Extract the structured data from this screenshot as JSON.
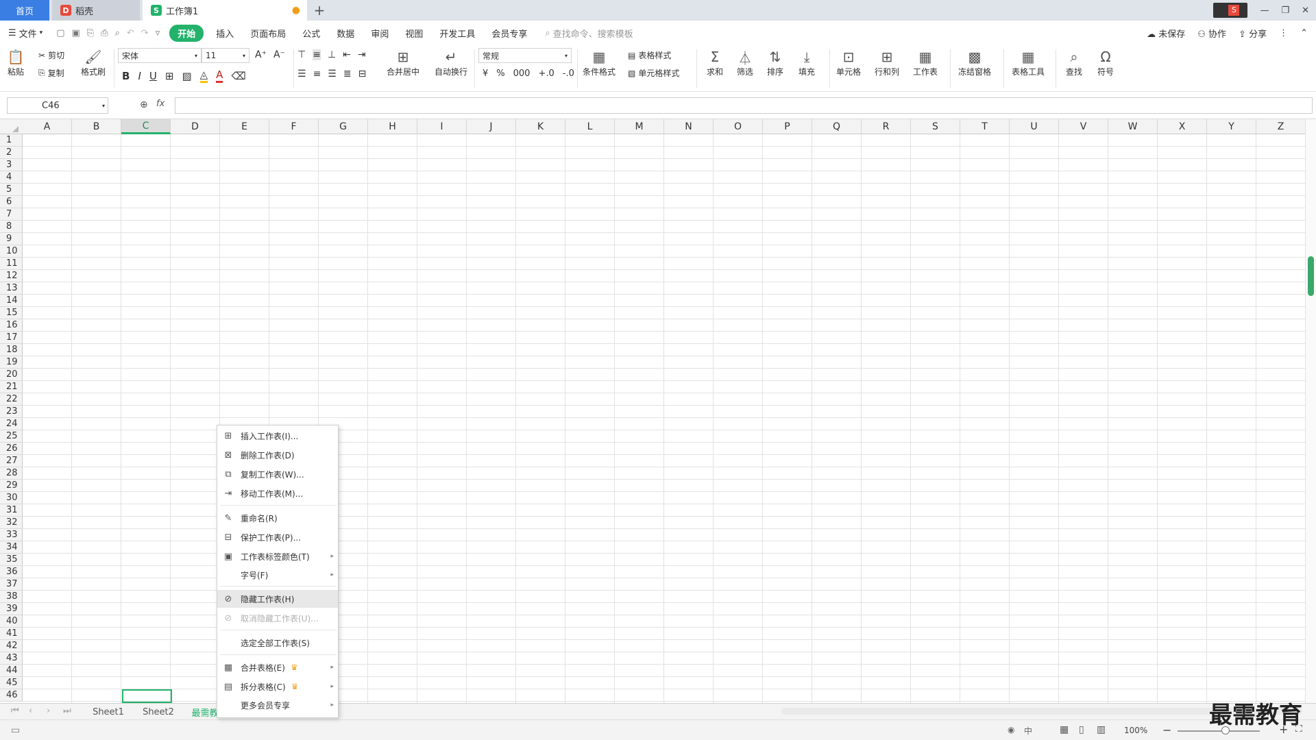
{
  "titlebar": {
    "home_tab": "首页",
    "draft_tab": "稻壳",
    "book_tab": "工作簿1",
    "add_tab": "+"
  },
  "menubar": {
    "file": "文件",
    "items": [
      "开始",
      "插入",
      "页面布局",
      "公式",
      "数据",
      "审阅",
      "视图",
      "开发工具",
      "会员专享"
    ],
    "search_placeholder": "查找命令、搜索模板",
    "unsaved": "未保存",
    "collab": "协作",
    "share": "分享"
  },
  "ribbon": {
    "paste": "粘贴",
    "cut": "剪切",
    "copy": "复制",
    "format_painter": "格式刷",
    "font_name": "宋体",
    "font_size": "11",
    "merge_center": "合并居中",
    "auto_wrap": "自动换行",
    "number_format": "常规",
    "conditional_format": "条件格式",
    "table_style": "表格样式",
    "cell_style": "单元格样式",
    "sum": "求和",
    "filter": "筛选",
    "sort": "排序",
    "fill": "填充",
    "cell": "单元格",
    "row_col": "行和列",
    "worksheet": "工作表",
    "freeze": "冻结窗格",
    "table_tools": "表格工具",
    "find": "查找",
    "symbol": "符号"
  },
  "formulabar": {
    "name_box": "C46",
    "fx": "fx"
  },
  "columns": [
    "A",
    "B",
    "C",
    "D",
    "E",
    "F",
    "G",
    "H",
    "I",
    "J",
    "K",
    "L",
    "M",
    "N",
    "O",
    "P",
    "Q",
    "R",
    "S",
    "T",
    "U",
    "V",
    "W",
    "X",
    "Y",
    "Z"
  ],
  "selected_column": "C",
  "active_cell": "C46",
  "rows": [
    "1",
    "2",
    "3",
    "4",
    "5",
    "6",
    "7",
    "8",
    "9",
    "10",
    "11",
    "12",
    "13",
    "14",
    "15",
    "16",
    "17",
    "18",
    "19",
    "20",
    "21",
    "22",
    "23",
    "24",
    "25",
    "26",
    "27",
    "28",
    "29",
    "30",
    "31",
    "32",
    "33",
    "34",
    "35",
    "36",
    "37",
    "38",
    "39",
    "40",
    "41",
    "42",
    "43",
    "44",
    "45",
    "46"
  ],
  "sheets": {
    "tabs": [
      "Sheet1",
      "Sheet2",
      "最需教"
    ]
  },
  "context_menu": {
    "insert": "插入工作表(I)...",
    "delete": "删除工作表(D)",
    "copy": "复制工作表(W)...",
    "move": "移动工作表(M)...",
    "rename": "重命名(R)",
    "protect": "保护工作表(P)...",
    "tab_color": "工作表标签颜色(T)",
    "font_size": "字号(F)",
    "hide": "隐藏工作表(H)",
    "unhide": "取消隐藏工作表(U)...",
    "select_all": "选定全部工作表(S)",
    "merge": "合并表格(E)",
    "split": "拆分表格(C)",
    "more_vip": "更多会员专享"
  },
  "statusbar": {
    "zoom": "100%"
  },
  "watermark": "最需教育",
  "colors": {
    "accent_green": "#23b26b",
    "home_blue": "#3a7ee3",
    "crown": "#f0a022"
  }
}
